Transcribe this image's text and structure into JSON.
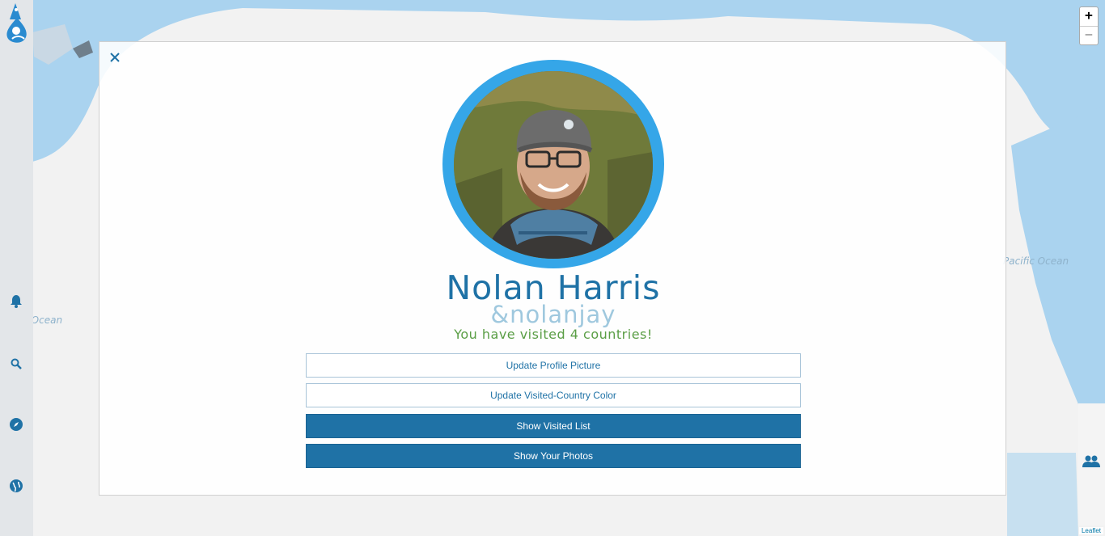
{
  "map": {
    "labels": [
      "Pacific Ocean",
      "Pacific Ocean"
    ],
    "zoom_in": "+",
    "zoom_out": "−",
    "attribution": "Leaflet"
  },
  "sidebar": {
    "icons": [
      "logo-icon",
      "bell-icon",
      "search-icon",
      "compass-icon",
      "globe-icon"
    ]
  },
  "profile": {
    "name": "Nolan Harris",
    "handle": "&nolanjay",
    "visited_text": "You have visited 4 countries!"
  },
  "buttons": {
    "update_picture": "Update Profile Picture",
    "update_color": "Update Visited-Country Color",
    "show_visited": "Show Visited List",
    "show_photos": "Show Your Photos"
  },
  "colors": {
    "accent": "#1f72a6",
    "avatar_ring": "#35a6e8",
    "visited_text": "#5a9e45",
    "handle": "#9fc8de"
  }
}
